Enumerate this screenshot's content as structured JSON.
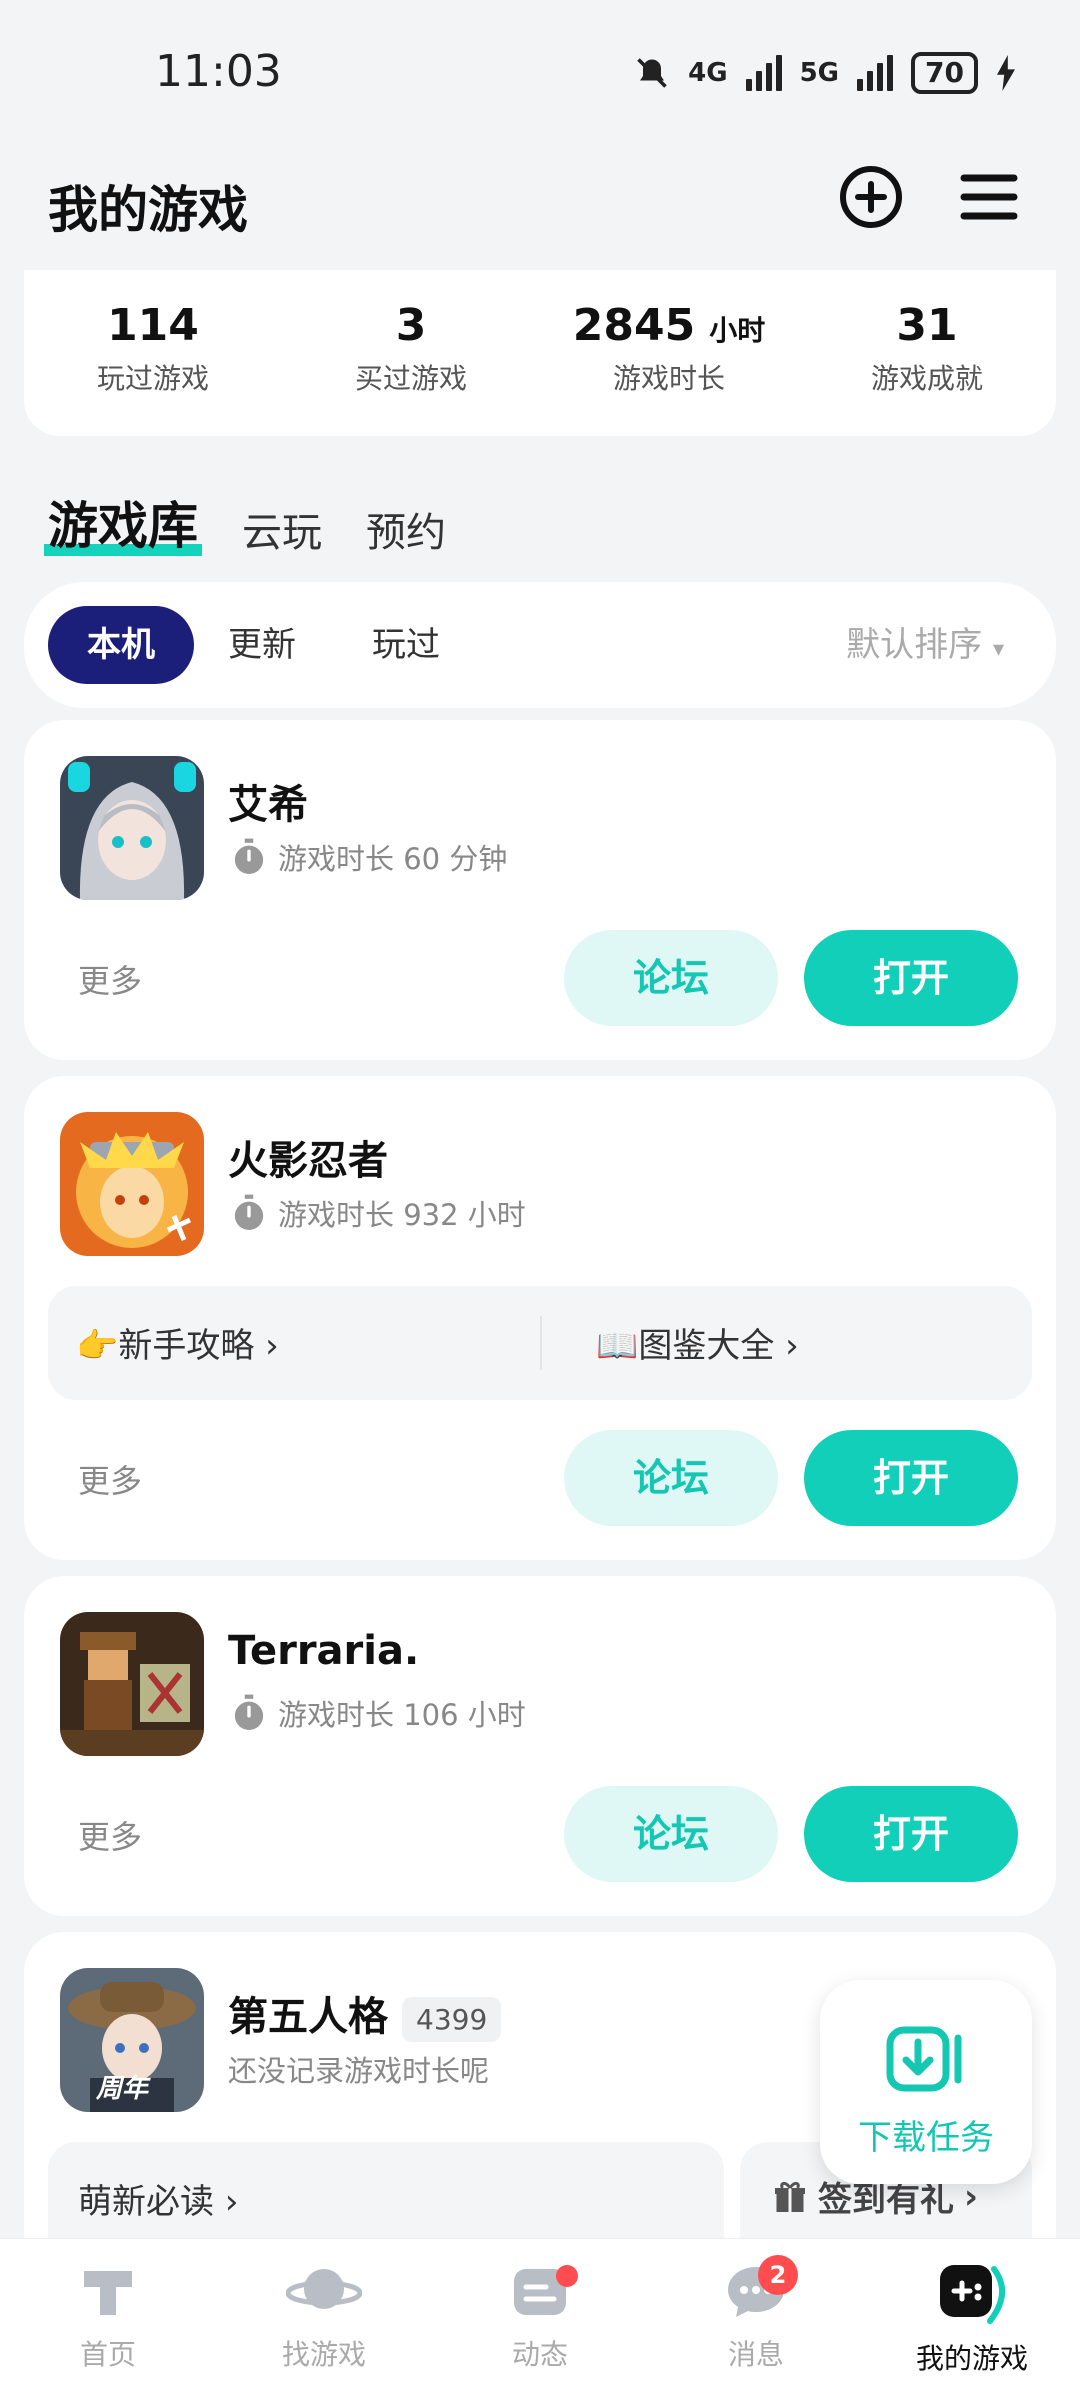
{
  "status": {
    "time": "11:03",
    "net1": "4G",
    "net2": "5G",
    "battery": "70"
  },
  "header": {
    "title": "我的游戏"
  },
  "stats": [
    {
      "value": "114",
      "label": "玩过游戏"
    },
    {
      "value": "3",
      "label": "买过游戏"
    },
    {
      "value": "2845",
      "unit": "小时",
      "label": "游戏时长"
    },
    {
      "value": "31",
      "label": "游戏成就"
    }
  ],
  "lib_tabs": [
    "游戏库",
    "云玩",
    "预约"
  ],
  "filters": {
    "chips": [
      "本机",
      "更新",
      "玩过"
    ],
    "sort": "默认排序"
  },
  "games": [
    {
      "name": "艾希",
      "time": "游戏时长 60 分钟",
      "more": "更多",
      "forum": "论坛",
      "open": "打开"
    },
    {
      "name": "火影忍者",
      "time": "游戏时长 932 小时",
      "guide1": "👉新手攻略",
      "guide2": "📖图鉴大全",
      "more": "更多",
      "forum": "论坛",
      "open": "打开"
    },
    {
      "name": "Terraria.",
      "time": "游戏时长 106 小时",
      "more": "更多",
      "forum": "论坛",
      "open": "打开"
    },
    {
      "name": "第五人格",
      "badge": "4399",
      "time": "还没记录游戏时长呢",
      "guide1": "萌新必读",
      "guide2": "签到有礼",
      "icon_text": "周年"
    }
  ],
  "download": {
    "label": "下载任务"
  },
  "nav": [
    {
      "label": "首页"
    },
    {
      "label": "找游戏"
    },
    {
      "label": "动态"
    },
    {
      "label": "消息",
      "badge": "2"
    },
    {
      "label": "我的游戏"
    }
  ],
  "colors": {
    "accent": "#12cfb9",
    "chip_active": "#1c1f7a",
    "badge_red": "#ff4d4f"
  }
}
